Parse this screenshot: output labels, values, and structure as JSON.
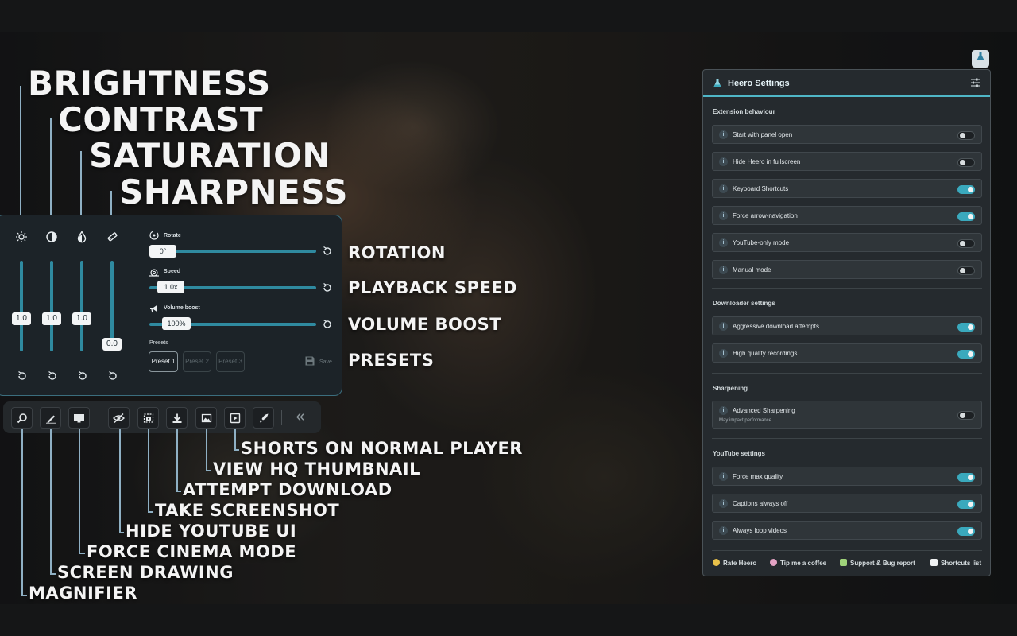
{
  "callouts": {
    "brightness": "BRIGHTNESS",
    "contrast": "CONTRAST",
    "saturation": "SATURATION",
    "sharpness": "SHARPNESS",
    "rotation": "ROTATION",
    "playback_speed": "PLAYBACK SPEED",
    "volume_boost": "VOLUME BOOST",
    "presets": "PRESETS",
    "shorts": "SHORTS ON NORMAL PLAYER",
    "hq_thumbnail": "VIEW HQ THUMBNAIL",
    "download": "ATTEMPT DOWNLOAD",
    "screenshot": "TAKE SCREENSHOT",
    "hide_ui": "HIDE YOUTUBE UI",
    "cinema": "FORCE CINEMA MODE",
    "drawing": "SCREEN DRAWING",
    "magnifier": "MAGNIFIER"
  },
  "controls": {
    "sliders": [
      {
        "name": "brightness",
        "icon": "brightness-icon",
        "value": "1.0"
      },
      {
        "name": "contrast",
        "icon": "contrast-icon",
        "value": "1.0"
      },
      {
        "name": "saturation",
        "icon": "saturation-icon",
        "value": "1.0"
      },
      {
        "name": "sharpness",
        "icon": "sharpness-icon",
        "value": "0.0"
      }
    ],
    "rotate": {
      "label": "Rotate",
      "value": "0°",
      "level": 0.0
    },
    "speed": {
      "label": "Speed",
      "value": "1.0x",
      "level": 0.12
    },
    "volume": {
      "label": "Volume boost",
      "value": "100%",
      "level": 0.1
    },
    "presets": {
      "label": "Presets",
      "items": [
        "Preset 1",
        "Preset 2",
        "Preset 3"
      ],
      "active": "Preset 1",
      "save": "Save"
    },
    "accent": "#2f8aa0"
  },
  "toolbar": {
    "buttons": [
      "magnifier-icon",
      "pen-icon",
      "monitor-icon",
      "eye-off-icon",
      "camera-icon",
      "download-icon",
      "image-icon",
      "shorts-icon",
      "rocket-icon"
    ],
    "collapse": "«"
  },
  "settings": {
    "title": "Heero Settings",
    "sections": {
      "extension": {
        "title": "Extension behaviour",
        "rows": [
          {
            "label": "Start with panel open",
            "on": false
          },
          {
            "label": "Hide Heero in fullscreen",
            "on": false
          },
          {
            "label": "Keyboard Shortcuts",
            "on": true
          },
          {
            "label": "Force arrow-navigation",
            "on": true
          },
          {
            "label": "YouTube-only mode",
            "on": false
          },
          {
            "label": "Manual mode",
            "on": false
          }
        ]
      },
      "downloader": {
        "title": "Downloader settings",
        "rows": [
          {
            "label": "Aggressive download attempts",
            "on": true
          },
          {
            "label": "High quality recordings",
            "on": true
          }
        ]
      },
      "sharpening": {
        "title": "Sharpening",
        "rows": [
          {
            "label": "Advanced Sharpening",
            "sub": "May impact performance",
            "on": false
          }
        ]
      },
      "youtube": {
        "title": "YouTube settings",
        "rows": [
          {
            "label": "Force max quality",
            "on": true
          },
          {
            "label": "Captions always off",
            "on": true
          },
          {
            "label": "Always loop videos",
            "on": true
          }
        ]
      }
    },
    "footer": {
      "rate": "Rate Heero",
      "tip": "Tip me a coffee",
      "support": "Support & Bug report",
      "shortcuts": "Shortcuts list"
    },
    "accent": "#3aa9bd"
  }
}
